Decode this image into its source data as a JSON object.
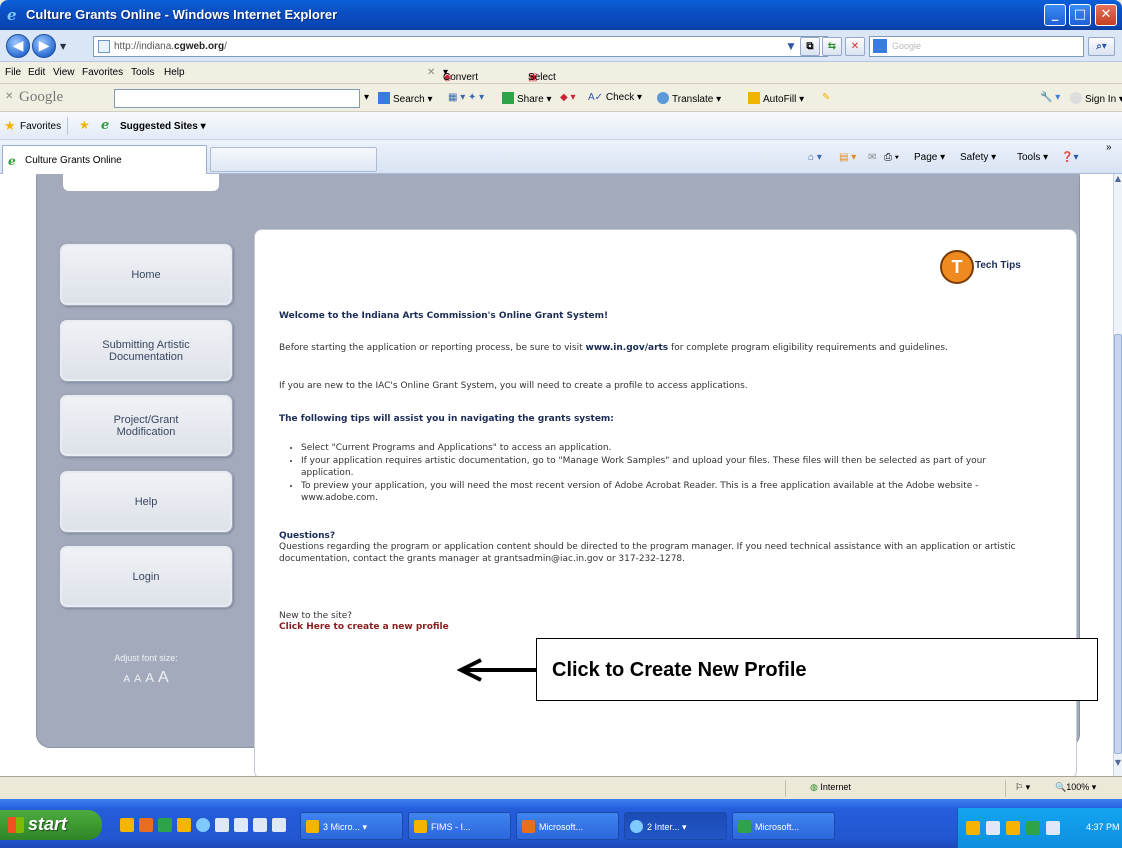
{
  "window": {
    "title": "Culture Grants Online - Windows Internet Explorer",
    "minimize": "_",
    "maximize": "□",
    "close": "✕"
  },
  "address": {
    "prefix": "http://indiana.",
    "domain": "cgweb.org",
    "suffix": "/",
    "search_placeholder": "Google"
  },
  "menu": {
    "items": [
      "File",
      "Edit",
      "View",
      "Favorites",
      "Tools",
      "Help"
    ],
    "convert": "Convert",
    "select": "Select"
  },
  "google_toolbar": {
    "logo": "Google",
    "search": "Search",
    "share": "Share",
    "check": "Check",
    "translate": "Translate",
    "autofill": "AutoFill",
    "sign_in": "Sign In"
  },
  "favorites": {
    "label": "Favorites",
    "suggested": "Suggested Sites"
  },
  "tab": {
    "label": "Culture Grants Online"
  },
  "commands": {
    "page": "Page",
    "safety": "Safety",
    "tools": "Tools"
  },
  "sidebar": {
    "items": [
      {
        "label": "Home"
      },
      {
        "label": "Submitting Artistic Documentation"
      },
      {
        "label": "Project/Grant Modification"
      },
      {
        "label": "Help"
      },
      {
        "label": "Login"
      }
    ],
    "font_size_label": "Adjust font size:",
    "font_sizes": [
      "A",
      "A",
      "A",
      "A"
    ]
  },
  "main": {
    "tech_logo": "T",
    "tech_tips": "Tech Tips",
    "welcome": "Welcome to the Indiana Arts Commission's Online Grant System!",
    "before_1": "Before starting the application or reporting process, be sure to visit ",
    "before_link": "www.in.gov/arts",
    "before_2": " for complete program eligibility requirements and guidelines.",
    "new_text": "If you are new to the IAC's Online Grant System, you will need to create a profile to access applications.",
    "tips_heading": "The following tips will assist you in navigating the grants system:",
    "tips": [
      "Select \"Current Programs and Applications\" to access an application.",
      "If your application requires artistic documentation, go to \"Manage Work Samples\" and upload your files. These files will then be selected as part of your application.",
      "To preview your application, you will need the most recent version of Adobe Acrobat Reader. This is a free application available at the Adobe website - www.adobe.com."
    ],
    "questions_heading": "Questions?",
    "questions_text": "Questions regarding the program or application content should be directed to the program manager. If you need technical assistance with an application or artistic documentation, contact the grants manager at grantsadmin@iac.in.gov or 317-232-1278.",
    "new_site": "New to the site?",
    "create_link": "Click Here to create a new profile"
  },
  "annotation": {
    "text": "Click to Create New Profile"
  },
  "status": {
    "zone": "Internet",
    "zoom": "100%"
  },
  "taskbar": {
    "start": "start",
    "tasks": [
      "3 Micro...",
      "FIMS - I...",
      "Microsoft...",
      "2 Inter...",
      "Microsoft..."
    ],
    "clock": "4:37 PM"
  }
}
